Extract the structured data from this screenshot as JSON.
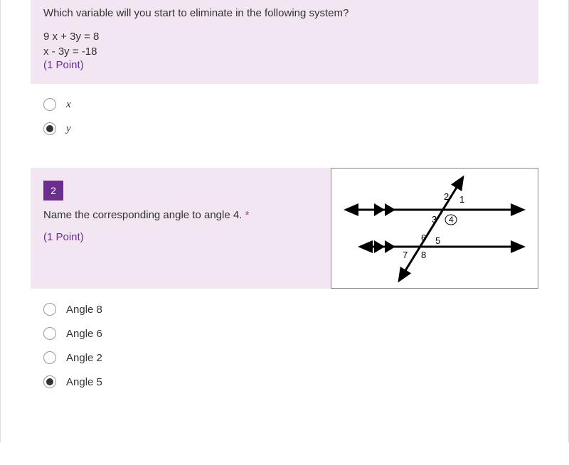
{
  "question1": {
    "prompt": "Which variable will you start to eliminate in the following system?",
    "eq1": "9 x + 3y = 8",
    "eq2": "x  -  3y = -18",
    "points": "(1 Point)",
    "options": [
      {
        "label": "x",
        "italic": true,
        "selected": false
      },
      {
        "label": "y",
        "italic": true,
        "selected": true
      }
    ]
  },
  "question2": {
    "number": "2",
    "prompt": "Name the corresponding angle to angle 4. ",
    "required": "*",
    "points": "(1 Point)",
    "diagram": {
      "labels": [
        "1",
        "2",
        "3",
        "4",
        "5",
        "6",
        "7",
        "8"
      ]
    },
    "options": [
      {
        "label": "Angle 8",
        "selected": false
      },
      {
        "label": "Angle 6",
        "selected": false
      },
      {
        "label": "Angle 2",
        "selected": false
      },
      {
        "label": "Angle 5",
        "selected": true
      }
    ]
  }
}
